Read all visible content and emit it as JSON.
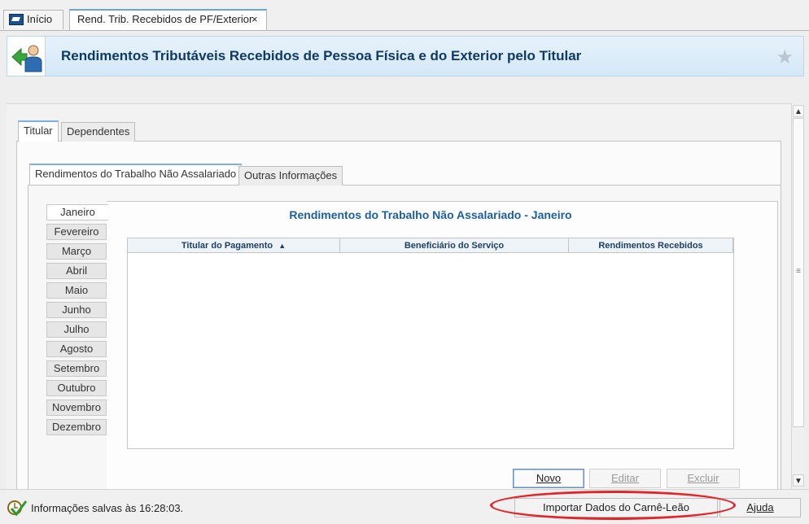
{
  "doc_tabs": [
    {
      "label": "Início",
      "icon": "home-flag-icon"
    },
    {
      "label": "Rend. Trib. Recebidos de PF/Exterior",
      "close": "×"
    }
  ],
  "header": {
    "title": "Rendimentos Tributáveis Recebidos de Pessoa Física e do Exterior pelo Titular",
    "star": "★"
  },
  "tabs_level1": [
    {
      "label": "Titular"
    },
    {
      "label": "Dependentes"
    }
  ],
  "tabs_level2": [
    {
      "label": "Rendimentos do Trabalho Não Assalariado"
    },
    {
      "label": "Outras Informações"
    }
  ],
  "months": [
    "Janeiro",
    "Fevereiro",
    "Março",
    "Abril",
    "Maio",
    "Junho",
    "Julho",
    "Agosto",
    "Setembro",
    "Outubro",
    "Novembro",
    "Dezembro"
  ],
  "panel_title": "Rendimentos do Trabalho Não Assalariado - Janeiro",
  "table": {
    "columns": [
      "Titular do Pagamento",
      "Beneficiário do Serviço",
      "Rendimentos Recebidos"
    ],
    "sort_indicator": "▲",
    "rows": []
  },
  "buttons": {
    "novo": "Novo",
    "editar": "Editar",
    "excluir": "Excluir",
    "importar": "Importar Dados do Carnê-Leão",
    "ajuda": "Ajuda"
  },
  "status": {
    "text": "Informações salvas às 16:28:03."
  },
  "scroll": {
    "up": "▲",
    "down": "▼",
    "grip": "≡"
  },
  "colors": {
    "accent": "#1d5e9c",
    "header_title": "#103a63",
    "annotation": "#e0262b"
  }
}
